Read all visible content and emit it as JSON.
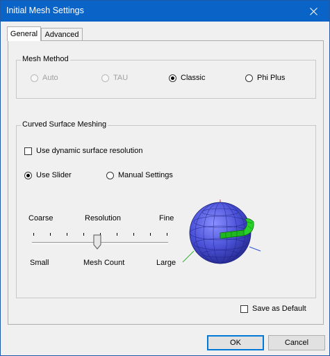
{
  "window": {
    "title": "Initial Mesh Settings"
  },
  "tabs": [
    {
      "label": "General",
      "active": true
    },
    {
      "label": "Advanced",
      "active": false
    }
  ],
  "mesh_method": {
    "legend": "Mesh Method",
    "options": [
      {
        "label": "Auto",
        "selected": false,
        "enabled": false
      },
      {
        "label": "TAU",
        "selected": false,
        "enabled": false
      },
      {
        "label": "Classic",
        "selected": true,
        "enabled": true
      },
      {
        "label": "Phi Plus",
        "selected": false,
        "enabled": true
      }
    ]
  },
  "curved_surface": {
    "legend": "Curved Surface Meshing",
    "dynamic_resolution": {
      "label": "Use dynamic surface resolution",
      "checked": false
    },
    "mode_options": [
      {
        "label": "Use Slider",
        "selected": true
      },
      {
        "label": "Manual Settings",
        "selected": false
      }
    ],
    "slider": {
      "top_labels": {
        "left": "Coarse",
        "center": "Resolution",
        "right": "Fine"
      },
      "bottom_labels": {
        "left": "Small",
        "center": "Mesh Count",
        "right": "Large"
      },
      "tick_count": 9,
      "position_index": 4
    },
    "preview_icon": "meshed-sphere-icon"
  },
  "save_default": {
    "label": "Save as Default",
    "checked": false
  },
  "buttons": {
    "ok": "OK",
    "cancel": "Cancel"
  },
  "colors": {
    "titlebar": "#0a64c8",
    "sphere": "#4b52d8",
    "mesh_band": "#28d228"
  }
}
